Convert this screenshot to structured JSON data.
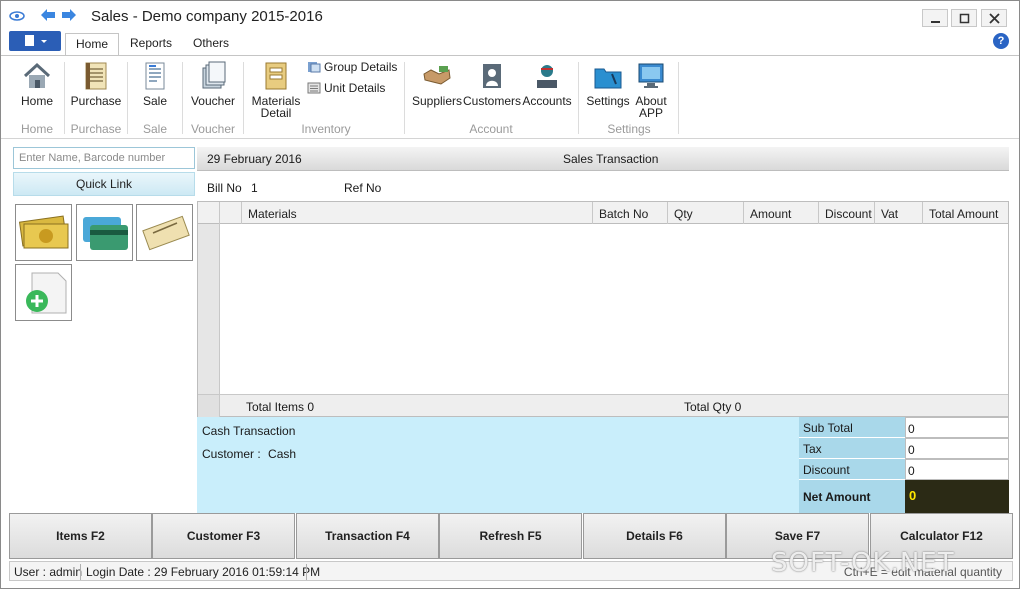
{
  "window": {
    "title": "Sales - Demo company 2015-2016"
  },
  "ribbon_tabs": [
    "Home",
    "Reports",
    "Others"
  ],
  "ribbon": {
    "home": "Home",
    "purchase": "Purchase",
    "sale": "Sale",
    "voucher": "Voucher",
    "materials_detail_1": "Materials",
    "materials_detail_2": "Detail",
    "group_details": "Group Details",
    "unit_details": "Unit Details",
    "suppliers": "Suppliers",
    "customers": "Customers",
    "accounts": "Accounts",
    "settings": "Settings",
    "about_1": "About",
    "about_2": "APP",
    "group_labels": {
      "home": "Home",
      "purchase": "Purchase",
      "sale": "Sale",
      "voucher": "Voucher",
      "inventory": "Inventory",
      "account": "Account",
      "settings": "Settings"
    }
  },
  "left_panel": {
    "search_placeholder": "Enter Name, Barcode number",
    "quick_link": "Quick Link"
  },
  "header": {
    "date": "29 February 2016",
    "title": "Sales Transaction"
  },
  "bill": {
    "bill_no_label": "Bill No",
    "bill_no": "1",
    "ref_no_label": "Ref No"
  },
  "grid": {
    "columns": [
      "Materials",
      "Batch No",
      "Qty",
      "Amount",
      "Discount",
      "Vat",
      "Total Amount"
    ],
    "total_items": "Total Items 0",
    "total_qty": "Total Qty 0"
  },
  "transaction": {
    "type": "Cash Transaction",
    "customer_label": "Customer :",
    "customer": "Cash"
  },
  "totals": {
    "sub_total_label": "Sub Total",
    "sub_total": "0",
    "tax_label": "Tax",
    "tax": "0",
    "discount_label": "Discount",
    "discount": "0",
    "net_amount_label": "Net Amount",
    "net_amount": "0"
  },
  "function_buttons": [
    "Items F2",
    "Customer F3",
    "Transaction F4",
    "Refresh F5",
    "Details F6",
    "Save F7",
    "Calculator F12"
  ],
  "status": {
    "user": "User : admin",
    "login": "Login Date : 29 February 2016 01:59:14 PM",
    "hint": "Ctrl+E = edit material quantity"
  },
  "watermark": "SOFT-OK.NET",
  "colors": {
    "accent": "#2b5eb6",
    "panel_bg": "#c9eefb",
    "totals_label_bg": "#a9d8ea",
    "net_amount_bg": "#2b2a15",
    "net_amount_fg": "#ffe800"
  }
}
